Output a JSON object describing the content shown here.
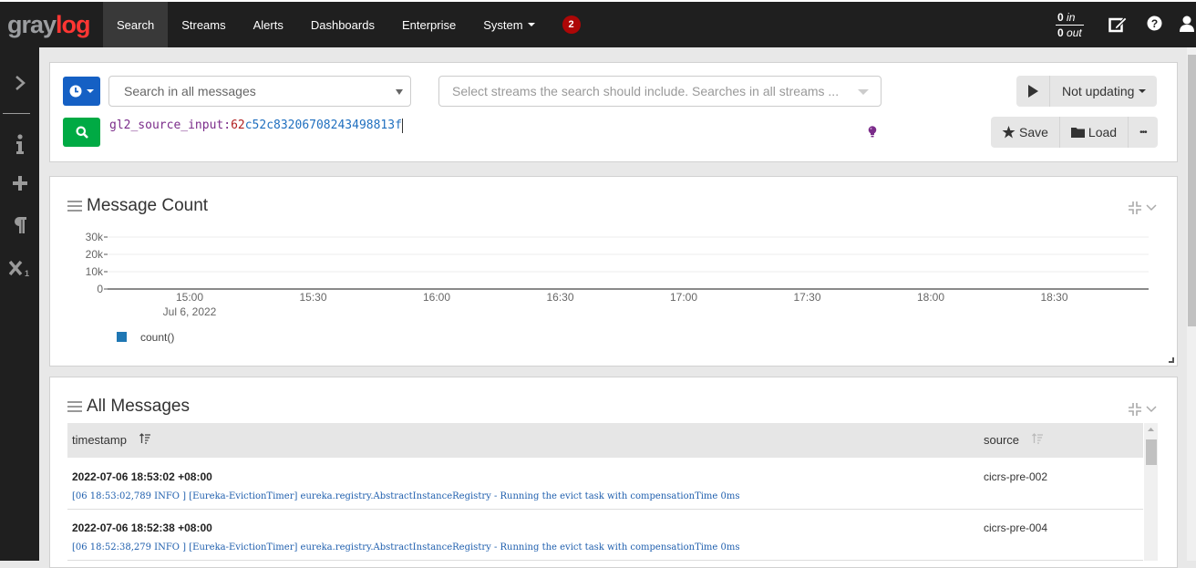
{
  "nav": {
    "logo_left": "gray",
    "logo_right": "log",
    "items": [
      {
        "label": "Search",
        "active": true
      },
      {
        "label": "Streams"
      },
      {
        "label": "Alerts"
      },
      {
        "label": "Dashboards"
      },
      {
        "label": "Enterprise"
      },
      {
        "label": "System"
      }
    ],
    "notification_count": "2",
    "throughput": {
      "in_count": "0",
      "in_label": "in",
      "out_count": "0",
      "out_label": "out"
    },
    "icons": [
      "edit-icon",
      "help-icon",
      "user-icon"
    ]
  },
  "sidebar": {
    "icons": [
      "expand-chevron-icon",
      "info-icon",
      "add-icon",
      "paragraph-icon",
      "subscript-icon"
    ]
  },
  "search": {
    "time_range_icon": "clock-icon",
    "scope_select": "Search in all messages",
    "streams_placeholder": "Select streams the search should include. Searches in all streams ...",
    "query_field": "gl2_source_input:",
    "query_num": "62",
    "query_value": "c52c83206708243498813f",
    "refresh_label": "Not updating",
    "save_label": "Save",
    "load_label": "Load",
    "more_label": "•••"
  },
  "message_count_widget": {
    "title": "Message Count"
  },
  "chart_data": {
    "type": "line",
    "title": "Message Count",
    "xlabel": "",
    "ylabel": "",
    "y_ticks": [
      "0",
      "10k",
      "20k",
      "30k"
    ],
    "ylim": [
      0,
      30000
    ],
    "x_ticks": [
      "15:00",
      "15:30",
      "16:00",
      "16:30",
      "17:00",
      "17:30",
      "18:00",
      "18:30"
    ],
    "x_subtitle": "Jul 6, 2022",
    "grid": true,
    "legend": "bottom-left",
    "series": [
      {
        "name": "count()",
        "color": "#1f77b4",
        "values": []
      }
    ]
  },
  "all_messages_widget": {
    "title": "All Messages",
    "columns": [
      "timestamp",
      "source"
    ],
    "rows": [
      {
        "timestamp": "2022-07-06 18:53:02 +08:00",
        "source": "cicrs-pre-002",
        "message": "[06 18:53:02,789 INFO ] [Eureka-EvictionTimer] eureka.registry.AbstractInstanceRegistry - Running the evict task with compensationTime 0ms"
      },
      {
        "timestamp": "2022-07-06 18:52:38 +08:00",
        "source": "cicrs-pre-004",
        "message": "[06 18:52:38,279 INFO ] [Eureka-EvictionTimer] eureka.registry.AbstractInstanceRegistry - Running the evict task with compensationTime 0ms"
      }
    ]
  }
}
